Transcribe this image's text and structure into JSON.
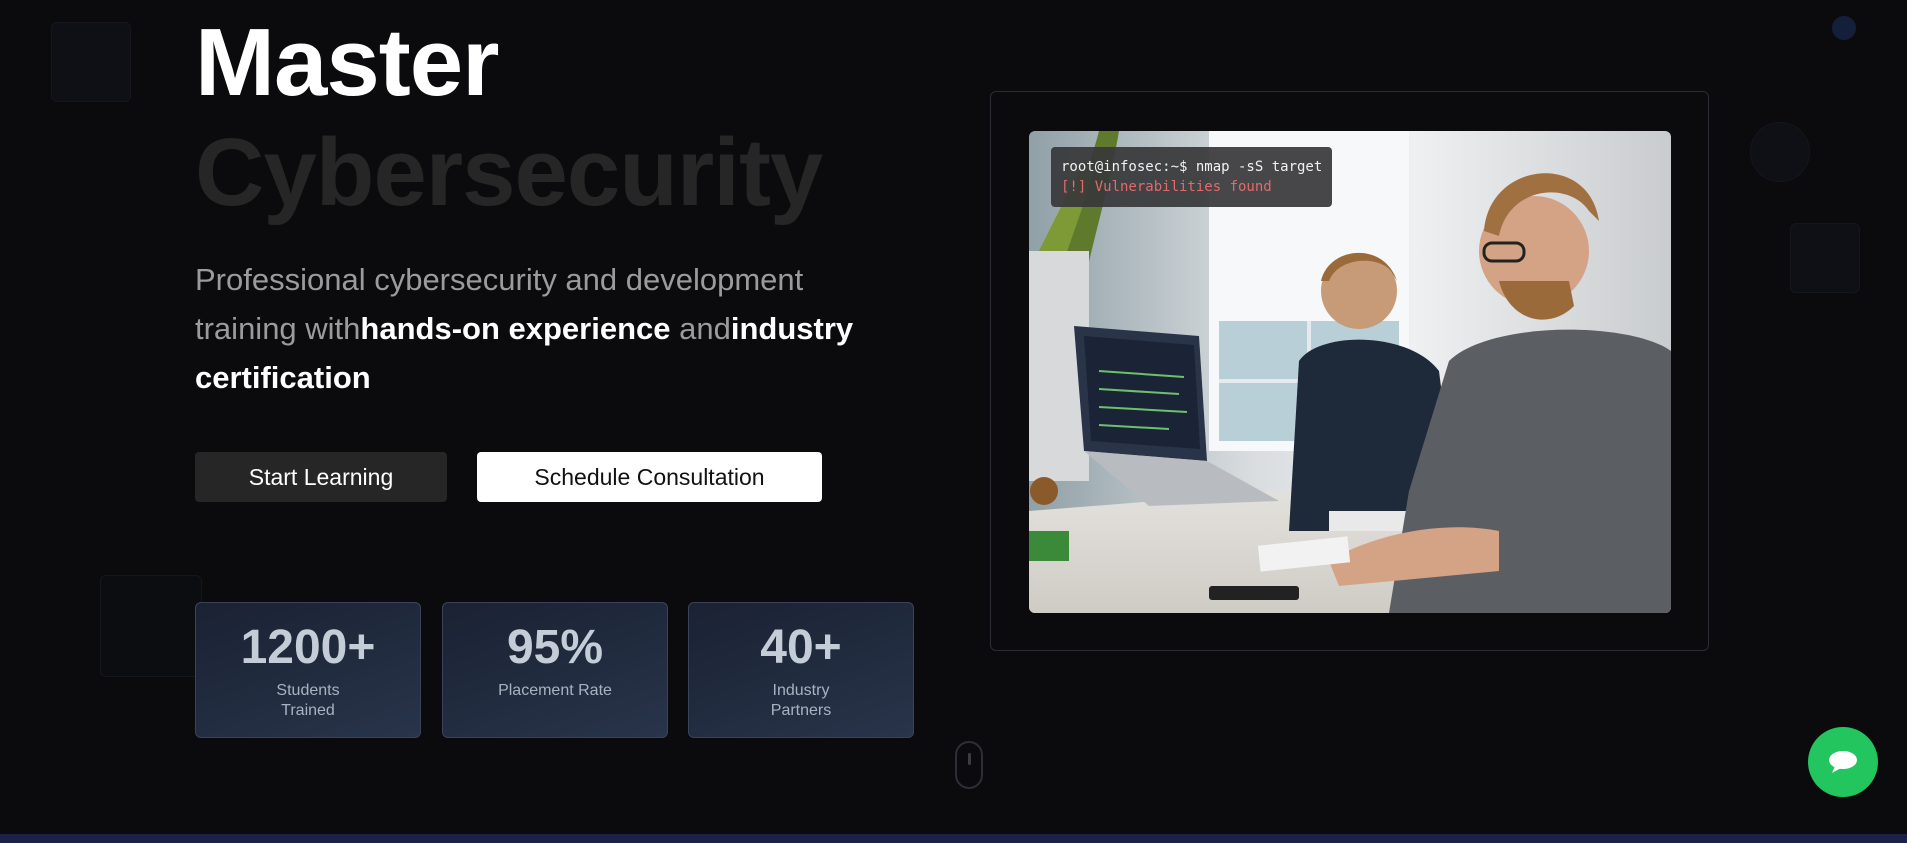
{
  "hero": {
    "title_line1": "Master",
    "title_line2": "Cybersecurity",
    "lead_prefix": "Professional cybersecurity and development training with",
    "lead_bold1": "hands-on experience",
    "lead_middle": " and",
    "lead_bold2": "industry certification"
  },
  "actions": {
    "primary_label": "Start Learning",
    "secondary_label": "Schedule Consultation"
  },
  "stats": [
    {
      "value": "1200+",
      "label": "Students Trained"
    },
    {
      "value": "95%",
      "label": "Placement Rate"
    },
    {
      "value": "40+",
      "label": "Industry Partners"
    }
  ],
  "terminal": {
    "command": "root@infosec:~$ nmap -sS target",
    "output": "[!] Vulnerabilities found"
  },
  "icons": {
    "chat": "chat-bubble-icon",
    "scroll": "mouse-scroll-icon"
  },
  "colors": {
    "background": "#0b0b0d",
    "accent_green": "#22c55e",
    "terminal_alert": "#e26a6a"
  }
}
